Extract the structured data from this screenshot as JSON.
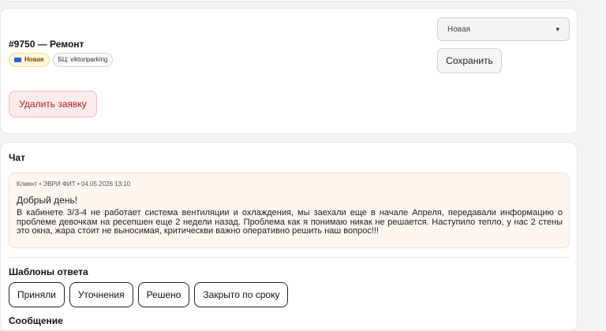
{
  "ticket": {
    "title": "#9750 — Ремонт",
    "status_badge": "Новая",
    "bc_badge": "БЦ: viktoriparking",
    "delete_label": "Удалить заявку",
    "status_select_value": "Новая",
    "save_label": "Сохранить"
  },
  "chat": {
    "title": "Чат",
    "message": {
      "meta": "Клиент • ЭВРИ ФИТ • 04.05.2026 13:10",
      "greeting": "Добрый день!",
      "body": "В кабинете 3/3-4 не работает система вентиляции и охлаждения, мы заехали еще в начале Апреля, передавали информацию о проблеме девочкам на ресепшен еще 2 недели назад. Проблема как я понимаю никак не решается. Наступило тепло, у нас 2 стены это окна, жара стоит не выносимая, критическви важно оперативно решить наш вопрос!!!"
    },
    "templates_title": "Шаблоны ответа",
    "templates": [
      "Приняли",
      "Уточнения",
      "Решено",
      "Закрыто по сроку"
    ],
    "message_label": "Сообщение"
  },
  "colors": {
    "status_badge_bg": "#fff7db",
    "delete_button_bg": "#fdecec",
    "message_bg": "#fdf6f1"
  }
}
